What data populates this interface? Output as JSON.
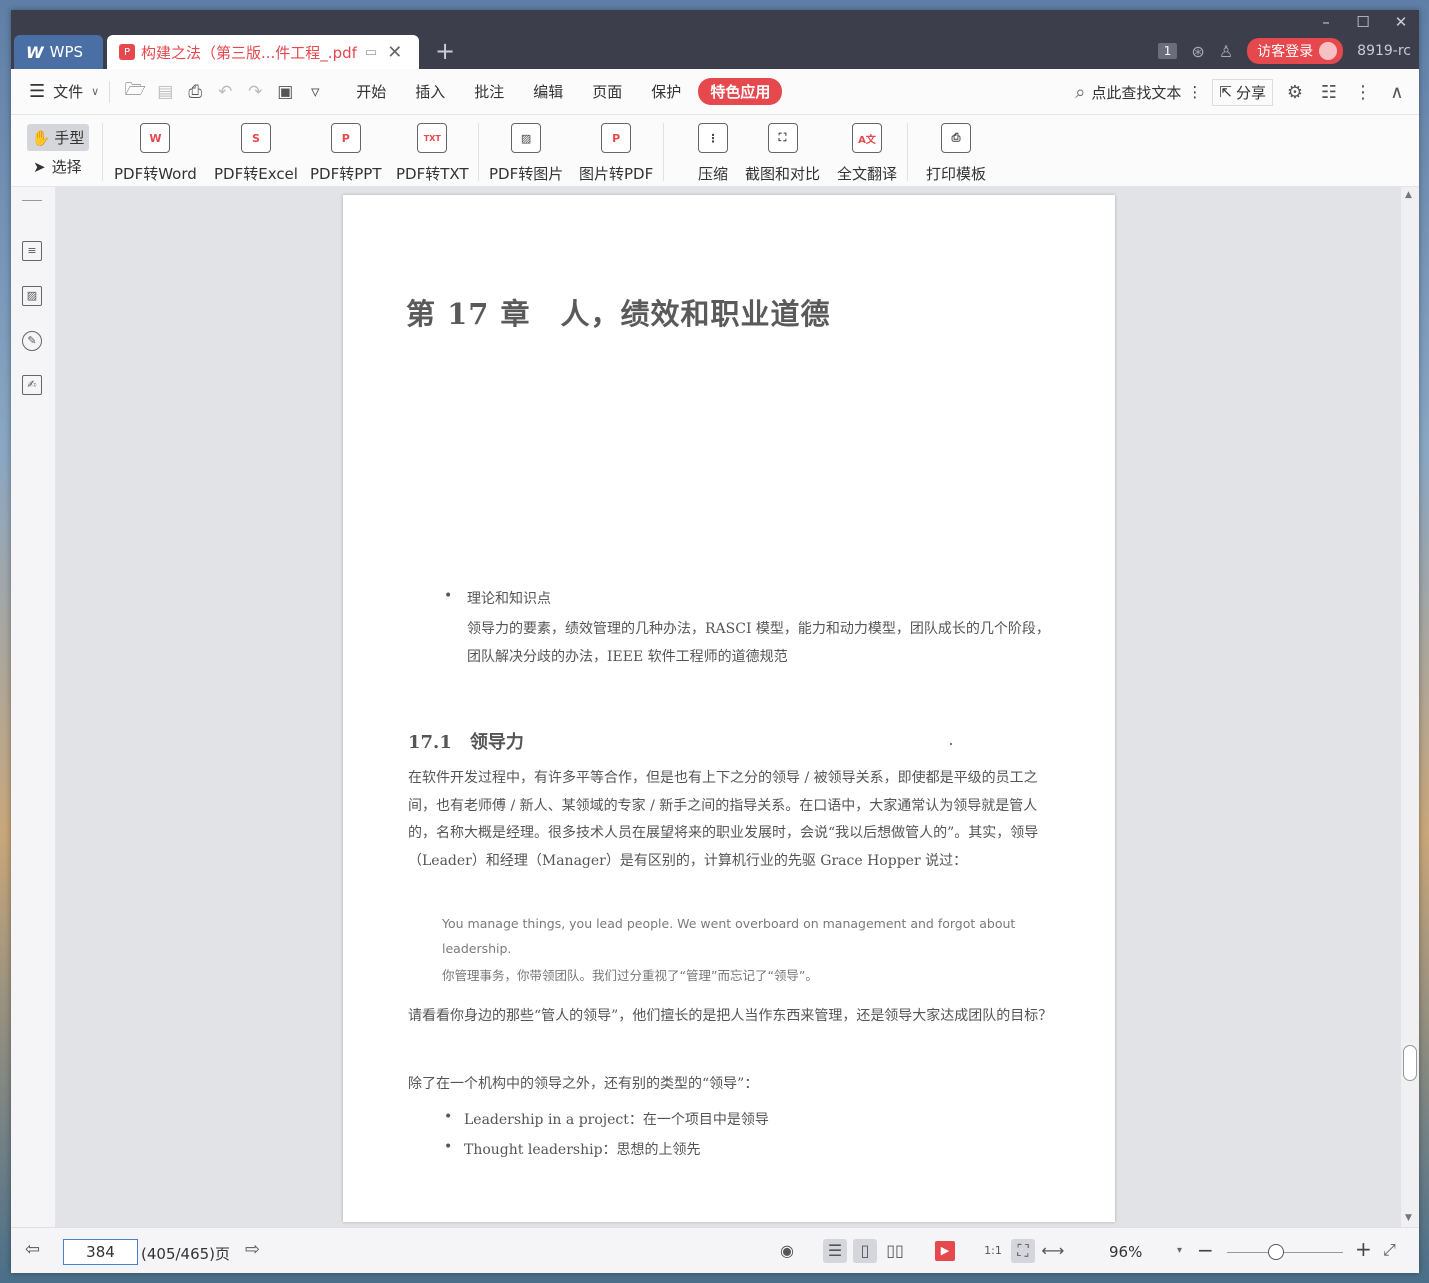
{
  "window": {
    "controls": {
      "minimize": "–",
      "maximize": "☐",
      "close": "✕"
    }
  },
  "tabs": {
    "home_label": "WPS",
    "doc_label": "构建之法（第三版...件工程_.pdf",
    "new_tab": "+"
  },
  "titlebar": {
    "page_badge": "1",
    "login_label": "访客登录",
    "user_label": "8919-rc"
  },
  "menubar": {
    "file_label": "文件",
    "tabs": [
      "开始",
      "插入",
      "批注",
      "编辑",
      "页面",
      "保护",
      "特色应用"
    ],
    "active_tab": "特色应用",
    "search_label": "点此查找文本",
    "share_label": "分享"
  },
  "ribbon": {
    "hand_label": "手型",
    "select_label": "选择",
    "buttons": [
      {
        "label": "PDF转Word",
        "icon": "W"
      },
      {
        "label": "PDF转Excel",
        "icon": "S"
      },
      {
        "label": "PDF转PPT",
        "icon": "P"
      },
      {
        "label": "PDF转TXT",
        "icon": "TXT"
      },
      {
        "label": "PDF转图片",
        "icon": "image"
      },
      {
        "label": "图片转PDF",
        "icon": "P"
      },
      {
        "label": "压缩",
        "icon": "zip"
      },
      {
        "label": "截图和对比",
        "icon": "crop"
      },
      {
        "label": "全文翻译",
        "icon": "A文"
      },
      {
        "label": "打印模板",
        "icon": "printer"
      }
    ]
  },
  "document": {
    "chapter_title": "第 17 章　人，绩效和职业道德",
    "knowledge_item": "理论和知识点",
    "knowledge_desc": "领导力的要素，绩效管理的几种办法，RASCI 模型，能力和动力模型，团队成长的几个阶段，团队解决分歧的办法，IEEE 软件工程师的道德规范",
    "section_title": "17.1　领导力",
    "para1": "在软件开发过程中，有许多平等合作，但是也有上下之分的领导 / 被领导关系，即使都是平级的员工之间，也有老师傅 / 新人、某领域的专家 / 新手之间的指导关系。在口语中，大家通常认为领导就是管人的，名称大概是经理。很多技术人员在展望将来的职业发展时，会说“我以后想做管人的”。其实，领导（Leader）和经理（Manager）是有区别的，计算机行业的先驱 Grace Hopper 说过：",
    "quote_en": "You manage things, you lead people. We went overboard on management and forgot about leadership.",
    "quote_zh": "你管理事务，你带领团队。我们过分重视了“管理”而忘记了“领导”。",
    "para2": "请看看你身边的那些“管人的领导”，他们擅长的是把人当作东西来管理，还是领导大家达成团队的目标？",
    "para3": "除了在一个机构中的领导之外，还有别的类型的“领导”：",
    "list": [
      "Leadership in a project：在一个项目中是领导",
      "Thought leadership：思想的上领先"
    ]
  },
  "statusbar": {
    "current_page": "384",
    "page_total": "(405/465)页",
    "zoom": "96%",
    "zoom_fraction": 0.42
  },
  "colors": {
    "accent": "#e5484d",
    "titlebar": "#3c3f4b",
    "home_tab": "#4a6fa5"
  }
}
